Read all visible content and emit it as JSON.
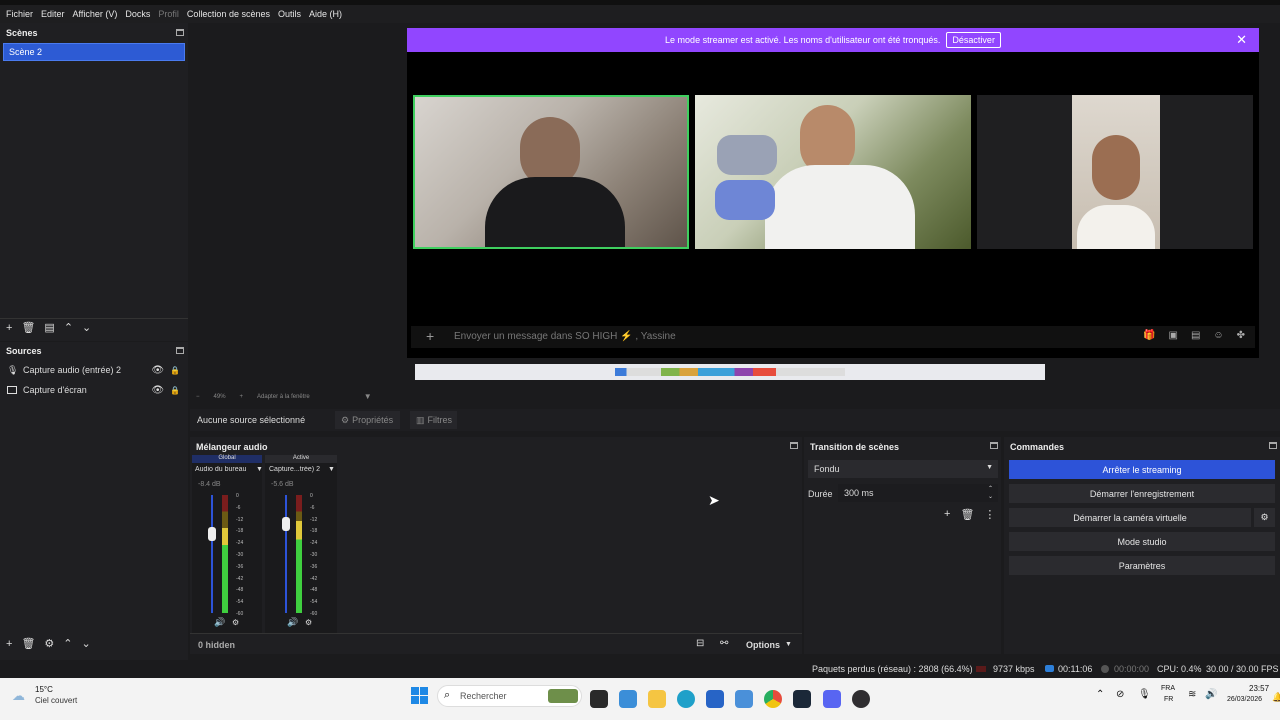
{
  "menu": {
    "items": [
      "Fichier",
      "Editer",
      "Afficher (V)",
      "Docks",
      "Profil",
      "Collection de scènes",
      "Outils",
      "Aide (H)"
    ]
  },
  "scenes": {
    "title": "Scènes",
    "items": [
      "Scène 2"
    ]
  },
  "sources": {
    "title": "Sources",
    "items": [
      {
        "label": "Capture audio (entrée) 2",
        "icon": "microphone-icon"
      },
      {
        "label": "Capture d'écran",
        "icon": "monitor-icon"
      }
    ]
  },
  "preview": {
    "banner_text": "Le mode streamer est activé. Les noms d'utilisateur ont été tronqués.",
    "banner_button": "Désactiver",
    "chat_placeholder": "Envoyer un message dans SO HIGH ⚡ , Yassine",
    "zoom": "49%",
    "fit_label": "Adapter à la fenêtre"
  },
  "source_toolbar": {
    "none_selected": "Aucune source sélectionné",
    "properties": "Propriétés",
    "filters": "Filtres"
  },
  "mixer": {
    "title": "Mélangeur audio",
    "channels": [
      {
        "tag": "Global",
        "name": "Audio du bureau",
        "db": "-8.4 dB",
        "level": 0.72
      },
      {
        "tag": "Active",
        "name": "Capture...trée) 2",
        "db": "-5.6 dB",
        "level": 0.78
      }
    ],
    "ticks": [
      "0",
      "-6",
      "-12",
      "-18",
      "-24",
      "-30",
      "-36",
      "-42",
      "-48",
      "-54",
      "-60"
    ],
    "hidden": "0 hidden",
    "options": "Options"
  },
  "transition": {
    "title": "Transition de scènes",
    "type": "Fondu",
    "duration_label": "Durée",
    "duration_value": "300 ms"
  },
  "commands": {
    "title": "Commandes",
    "stop_streaming": "Arrêter le streaming",
    "start_recording": "Démarrer l'enregistrement",
    "virtual_camera": "Démarrer la caméra virtuelle",
    "studio_mode": "Mode studio",
    "settings": "Paramètres"
  },
  "status": {
    "dropped": "Paquets perdus (réseau) : 2808 (66.4%)",
    "bitrate": "9737 kbps",
    "stream_time": "00:11:06",
    "rec_time": "00:00:00",
    "cpu": "CPU: 0.4%",
    "fps": "30.00 / 30.00 FPS"
  },
  "taskbar": {
    "temp": "15°C",
    "weather": "Ciel couvert",
    "search": "Rechercher",
    "lang1": "FRA",
    "lang2": "FR",
    "time": "23:57",
    "date": "26/03/2026"
  },
  "colors": {
    "accent": "#2d53d8",
    "twitch": "#9146ff",
    "meter_green": "#3fcf3f"
  }
}
